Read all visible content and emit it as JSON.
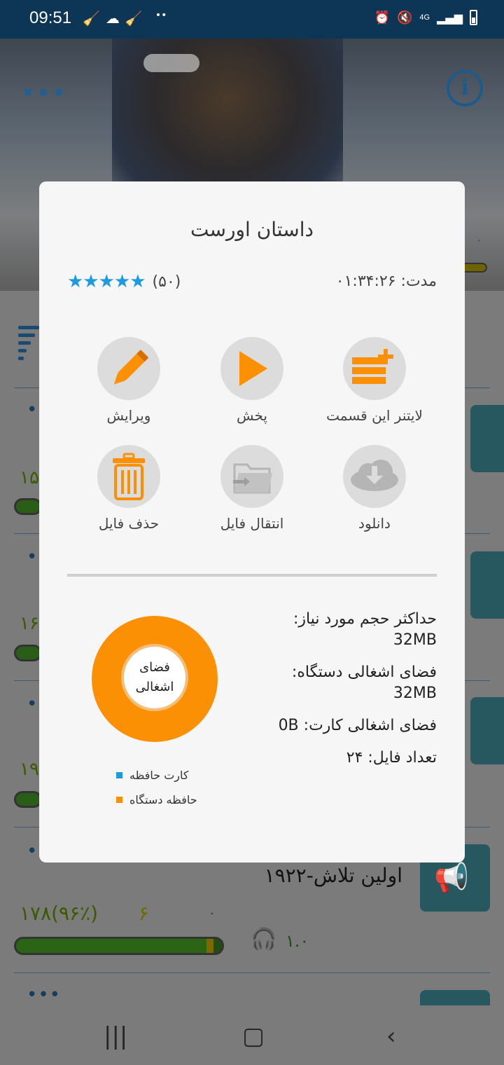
{
  "status_bar": {
    "time": "09:51",
    "network": "4G"
  },
  "dialog": {
    "title": "داستان اورست",
    "duration_label": "مدت:",
    "duration_value": "۰۱:۳۴:۲۶",
    "stars": "★★★★★",
    "rating_count": "(۵۰)",
    "actions": [
      {
        "label": "لایتنر این قسمت",
        "icon": "add-list-icon"
      },
      {
        "label": "پخش",
        "icon": "play-icon"
      },
      {
        "label": "ویرایش",
        "icon": "pencil-icon"
      },
      {
        "label": "دانلود",
        "icon": "cloud-download-icon"
      },
      {
        "label": "انتقال فایل",
        "icon": "folder-move-icon"
      },
      {
        "label": "حذف فایل",
        "icon": "trash-icon"
      }
    ],
    "storage": {
      "max_size_label": "حداکثر حجم مورد نیاز:",
      "max_size_value": "32MB",
      "device_label": "فضای اشغالی دستگاه:",
      "device_value": "32MB",
      "card_label": "فضای اشغالی کارت:",
      "card_value": "0B",
      "files_label": "تعداد فایل:",
      "files_value": "۲۴"
    },
    "donut_label": "فضای اشغالی",
    "legend": [
      {
        "label": "کارت حافظه",
        "color": "#1e9be0"
      },
      {
        "label": "حافظه دستگاه",
        "color": "#fb9005"
      }
    ]
  },
  "background_list": {
    "row_numbers": [
      "۱۵",
      "۱۶",
      "۱۹"
    ],
    "last_row": {
      "title": "اولین تلاش-۱۹۲۲",
      "progress_text": "۱۷۸(۹۶٪)",
      "count_a": "۶",
      "count_b": "۰",
      "listens": "۱.۰",
      "progress_fraction": 0.96
    },
    "header_counter": "۰"
  },
  "colors": {
    "accent": "#fb9005",
    "star": "#1e9be0",
    "status_bar": "#0d3556"
  }
}
